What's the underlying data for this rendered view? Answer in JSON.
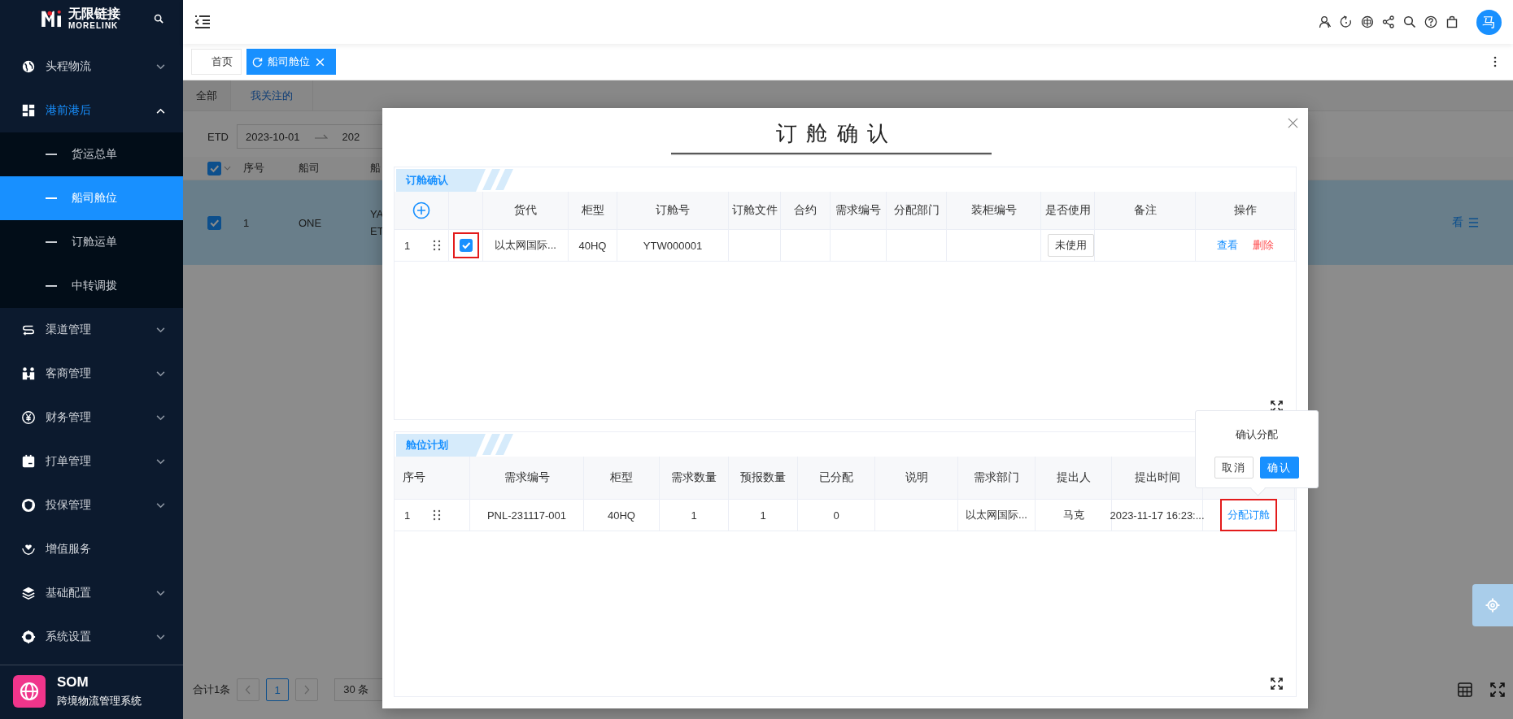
{
  "sidebar": {
    "logo": {
      "name": "无限链接",
      "subname": "MORELINK"
    },
    "items": [
      {
        "label": "头程物流",
        "expandable": true,
        "expanded": false,
        "selected": false
      },
      {
        "label": "港前港后",
        "expandable": true,
        "expanded": true,
        "selected": true,
        "children": [
          {
            "label": "货运总单",
            "selected": false
          },
          {
            "label": "船司舱位",
            "selected": true
          },
          {
            "label": "订舱运单",
            "selected": false
          },
          {
            "label": "中转调拨",
            "selected": false
          }
        ]
      },
      {
        "label": "渠道管理",
        "expandable": true,
        "expanded": false,
        "selected": false
      },
      {
        "label": "客商管理",
        "expandable": true,
        "expanded": false,
        "selected": false
      },
      {
        "label": "财务管理",
        "expandable": true,
        "expanded": false,
        "selected": false
      },
      {
        "label": "打单管理",
        "expandable": true,
        "expanded": false,
        "selected": false
      },
      {
        "label": "投保管理",
        "expandable": true,
        "expanded": false,
        "selected": false
      },
      {
        "label": "增值服务",
        "expandable": false,
        "expanded": false,
        "selected": false
      },
      {
        "label": "基础配置",
        "expandable": true,
        "expanded": false,
        "selected": false
      },
      {
        "label": "系统设置",
        "expandable": true,
        "expanded": false,
        "selected": false
      }
    ],
    "footer": {
      "title": "SOM",
      "subtitle": "跨境物流管理系统"
    }
  },
  "header": {
    "avatar": "马"
  },
  "page_tabs": [
    {
      "label": "首页",
      "selected": false
    },
    {
      "label": "船司舱位",
      "selected": true
    }
  ],
  "page": {
    "view_tabs": [
      {
        "label": "全部",
        "selected": false
      },
      {
        "label": "我关注的",
        "selected": true
      }
    ],
    "filter": {
      "label": "ETD",
      "start": "2023-10-01",
      "end": "202"
    },
    "table": {
      "all_checked": true,
      "columns": [
        "序号",
        "船司",
        "船"
      ],
      "rows": [
        {
          "checked": true,
          "selected": true,
          "index": "1",
          "carrier": "ONE",
          "column_3": [
            "YA",
            "ET"
          ],
          "action": "看"
        }
      ]
    },
    "pagination": {
      "total": "合计1条",
      "pages": [
        {
          "label": "1",
          "selected": true
        }
      ],
      "page_size": "30 条"
    }
  },
  "modal": {
    "title": "订 舱 确 认",
    "booking": {
      "title": "订舱确认",
      "columns": [
        "货代",
        "柜型",
        "订舱号",
        "订舱文件",
        "合约",
        "需求编号",
        "分配部门",
        "装柜编号",
        "是否使用",
        "备注",
        "操作"
      ],
      "rows": [
        {
          "index": "1",
          "checked": true,
          "highlighted": true,
          "forwarder": "以太网国际...",
          "container_type": "40HQ",
          "booking_no": "YTW000001",
          "usage": "未使用",
          "actions": [
            {
              "label": "查看",
              "kind": "view"
            },
            {
              "label": "删除",
              "kind": "delete"
            }
          ]
        }
      ]
    },
    "plan": {
      "title": "舱位计划",
      "columns": [
        "序号",
        "需求编号",
        "柜型",
        "需求数量",
        "预报数量",
        "已分配",
        "说明",
        "需求部门",
        "提出人",
        "提出时间"
      ],
      "rows": [
        {
          "index": "1",
          "demand_no": "PNL-231117-001",
          "container_type": "40HQ",
          "demand_qty": "1",
          "forecast_qty": "1",
          "allocated": "0",
          "department": "以太网国际...",
          "proposer": "马克",
          "time": "2023-11-17 16:23:...",
          "action": "分配订舱",
          "highlighted": true
        }
      ]
    },
    "popconfirm": {
      "message": "确认分配",
      "cancel": "取消",
      "confirm": "确认"
    }
  }
}
